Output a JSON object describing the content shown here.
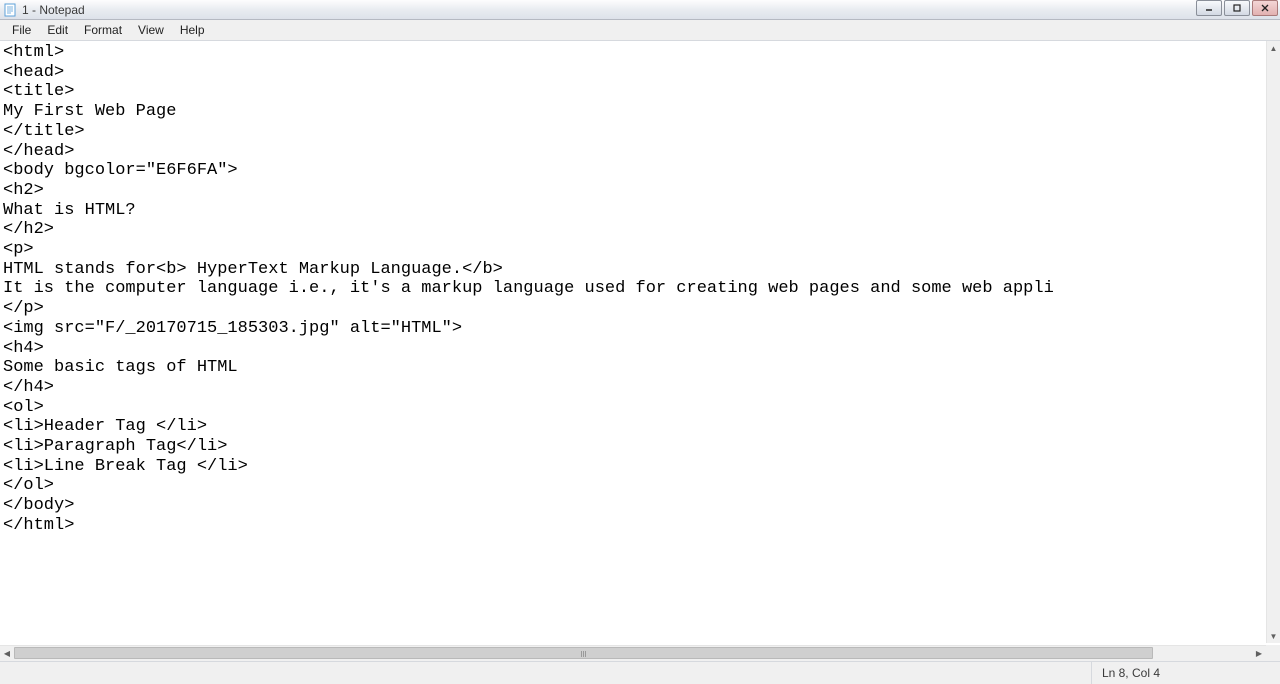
{
  "window": {
    "title": "1 - Notepad"
  },
  "menu": {
    "items": [
      "File",
      "Edit",
      "Format",
      "View",
      "Help"
    ]
  },
  "content": {
    "text": "<html>\n<head>\n<title>\nMy First Web Page\n</title>\n</head>\n<body bgcolor=\"E6F6FA\">\n<h2>\nWhat is HTML?\n</h2>\n<p>\nHTML stands for<b> HyperText Markup Language.</b>\nIt is the computer language i.e., it's a markup language used for creating web pages and some web appli\n</p>\n<img src=\"F/_20170715_185303.jpg\" alt=\"HTML\">\n<h4>\nSome basic tags of HTML\n</h4>\n<ol>\n<li>Header Tag </li>\n<li>Paragraph Tag</li>\n<li>Line Break Tag </li>\n</ol>\n</body>\n</html>"
  },
  "status": {
    "position": "Ln 8, Col 4"
  }
}
